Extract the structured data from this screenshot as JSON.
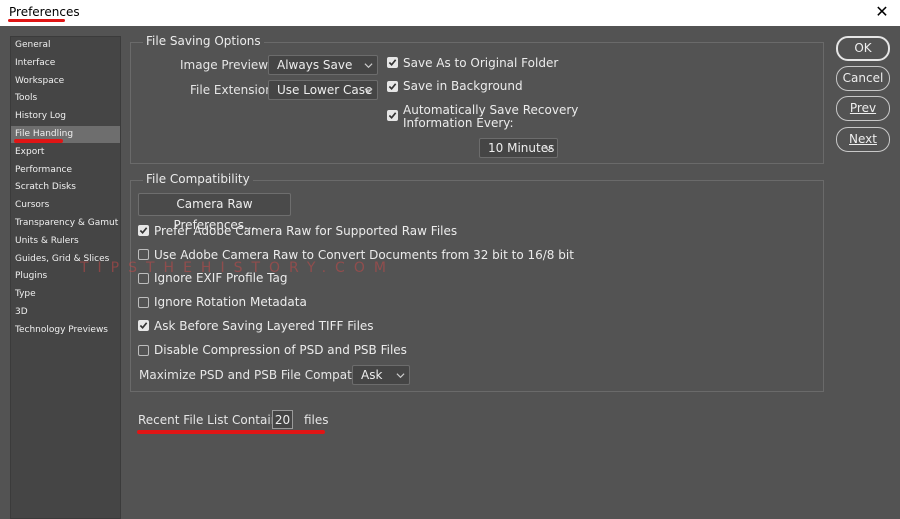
{
  "window": {
    "title": "Preferences",
    "close_glyph": "✕"
  },
  "sidebar": {
    "items": [
      {
        "label": "General"
      },
      {
        "label": "Interface"
      },
      {
        "label": "Workspace"
      },
      {
        "label": "Tools"
      },
      {
        "label": "History Log"
      },
      {
        "label": "File Handling",
        "selected": true
      },
      {
        "label": "Export"
      },
      {
        "label": "Performance"
      },
      {
        "label": "Scratch Disks"
      },
      {
        "label": "Cursors"
      },
      {
        "label": "Transparency & Gamut"
      },
      {
        "label": "Units & Rulers"
      },
      {
        "label": "Guides, Grid & Slices"
      },
      {
        "label": "Plugins"
      },
      {
        "label": "Type"
      },
      {
        "label": "3D"
      },
      {
        "label": "Technology Previews"
      }
    ]
  },
  "file_saving": {
    "title": "File Saving Options",
    "image_previews_label": "Image Previews:",
    "image_previews_value": "Always Save",
    "file_extension_label": "File Extension:",
    "file_extension_value": "Use Lower Case",
    "save_as_original": {
      "label": "Save As to Original Folder",
      "checked": true
    },
    "save_in_background": {
      "label": "Save in Background",
      "checked": true
    },
    "auto_save": {
      "label_line1": "Automatically Save Recovery",
      "label_line2": "Information Every:",
      "checked": true
    },
    "interval_value": "10 Minutes"
  },
  "file_compat": {
    "title": "File Compatibility",
    "camera_raw_button": "Camera Raw Preferences...",
    "options": [
      {
        "label": "Prefer Adobe Camera Raw for Supported Raw Files",
        "checked": true
      },
      {
        "label": "Use Adobe Camera Raw to Convert Documents from 32 bit to 16/8 bit",
        "checked": false
      },
      {
        "label": "Ignore EXIF Profile Tag",
        "checked": false
      },
      {
        "label": "Ignore Rotation Metadata",
        "checked": false
      },
      {
        "label": "Ask Before Saving Layered TIFF Files",
        "checked": true
      },
      {
        "label": "Disable Compression of PSD and PSB Files",
        "checked": false
      }
    ],
    "maximize_label": "Maximize PSD and PSB File Compatibility:",
    "maximize_value": "Ask"
  },
  "recent_files": {
    "label": "Recent File List Contains:",
    "value": "20",
    "suffix": "files"
  },
  "buttons": {
    "ok": "OK",
    "cancel": "Cancel",
    "prev": "Prev",
    "next": "Next"
  },
  "watermark": "TIPSTHEHISTORY.COM",
  "colors": {
    "accent_underline": "#e01515",
    "panel_bg": "#535353",
    "sidebar_bg": "#454545"
  }
}
